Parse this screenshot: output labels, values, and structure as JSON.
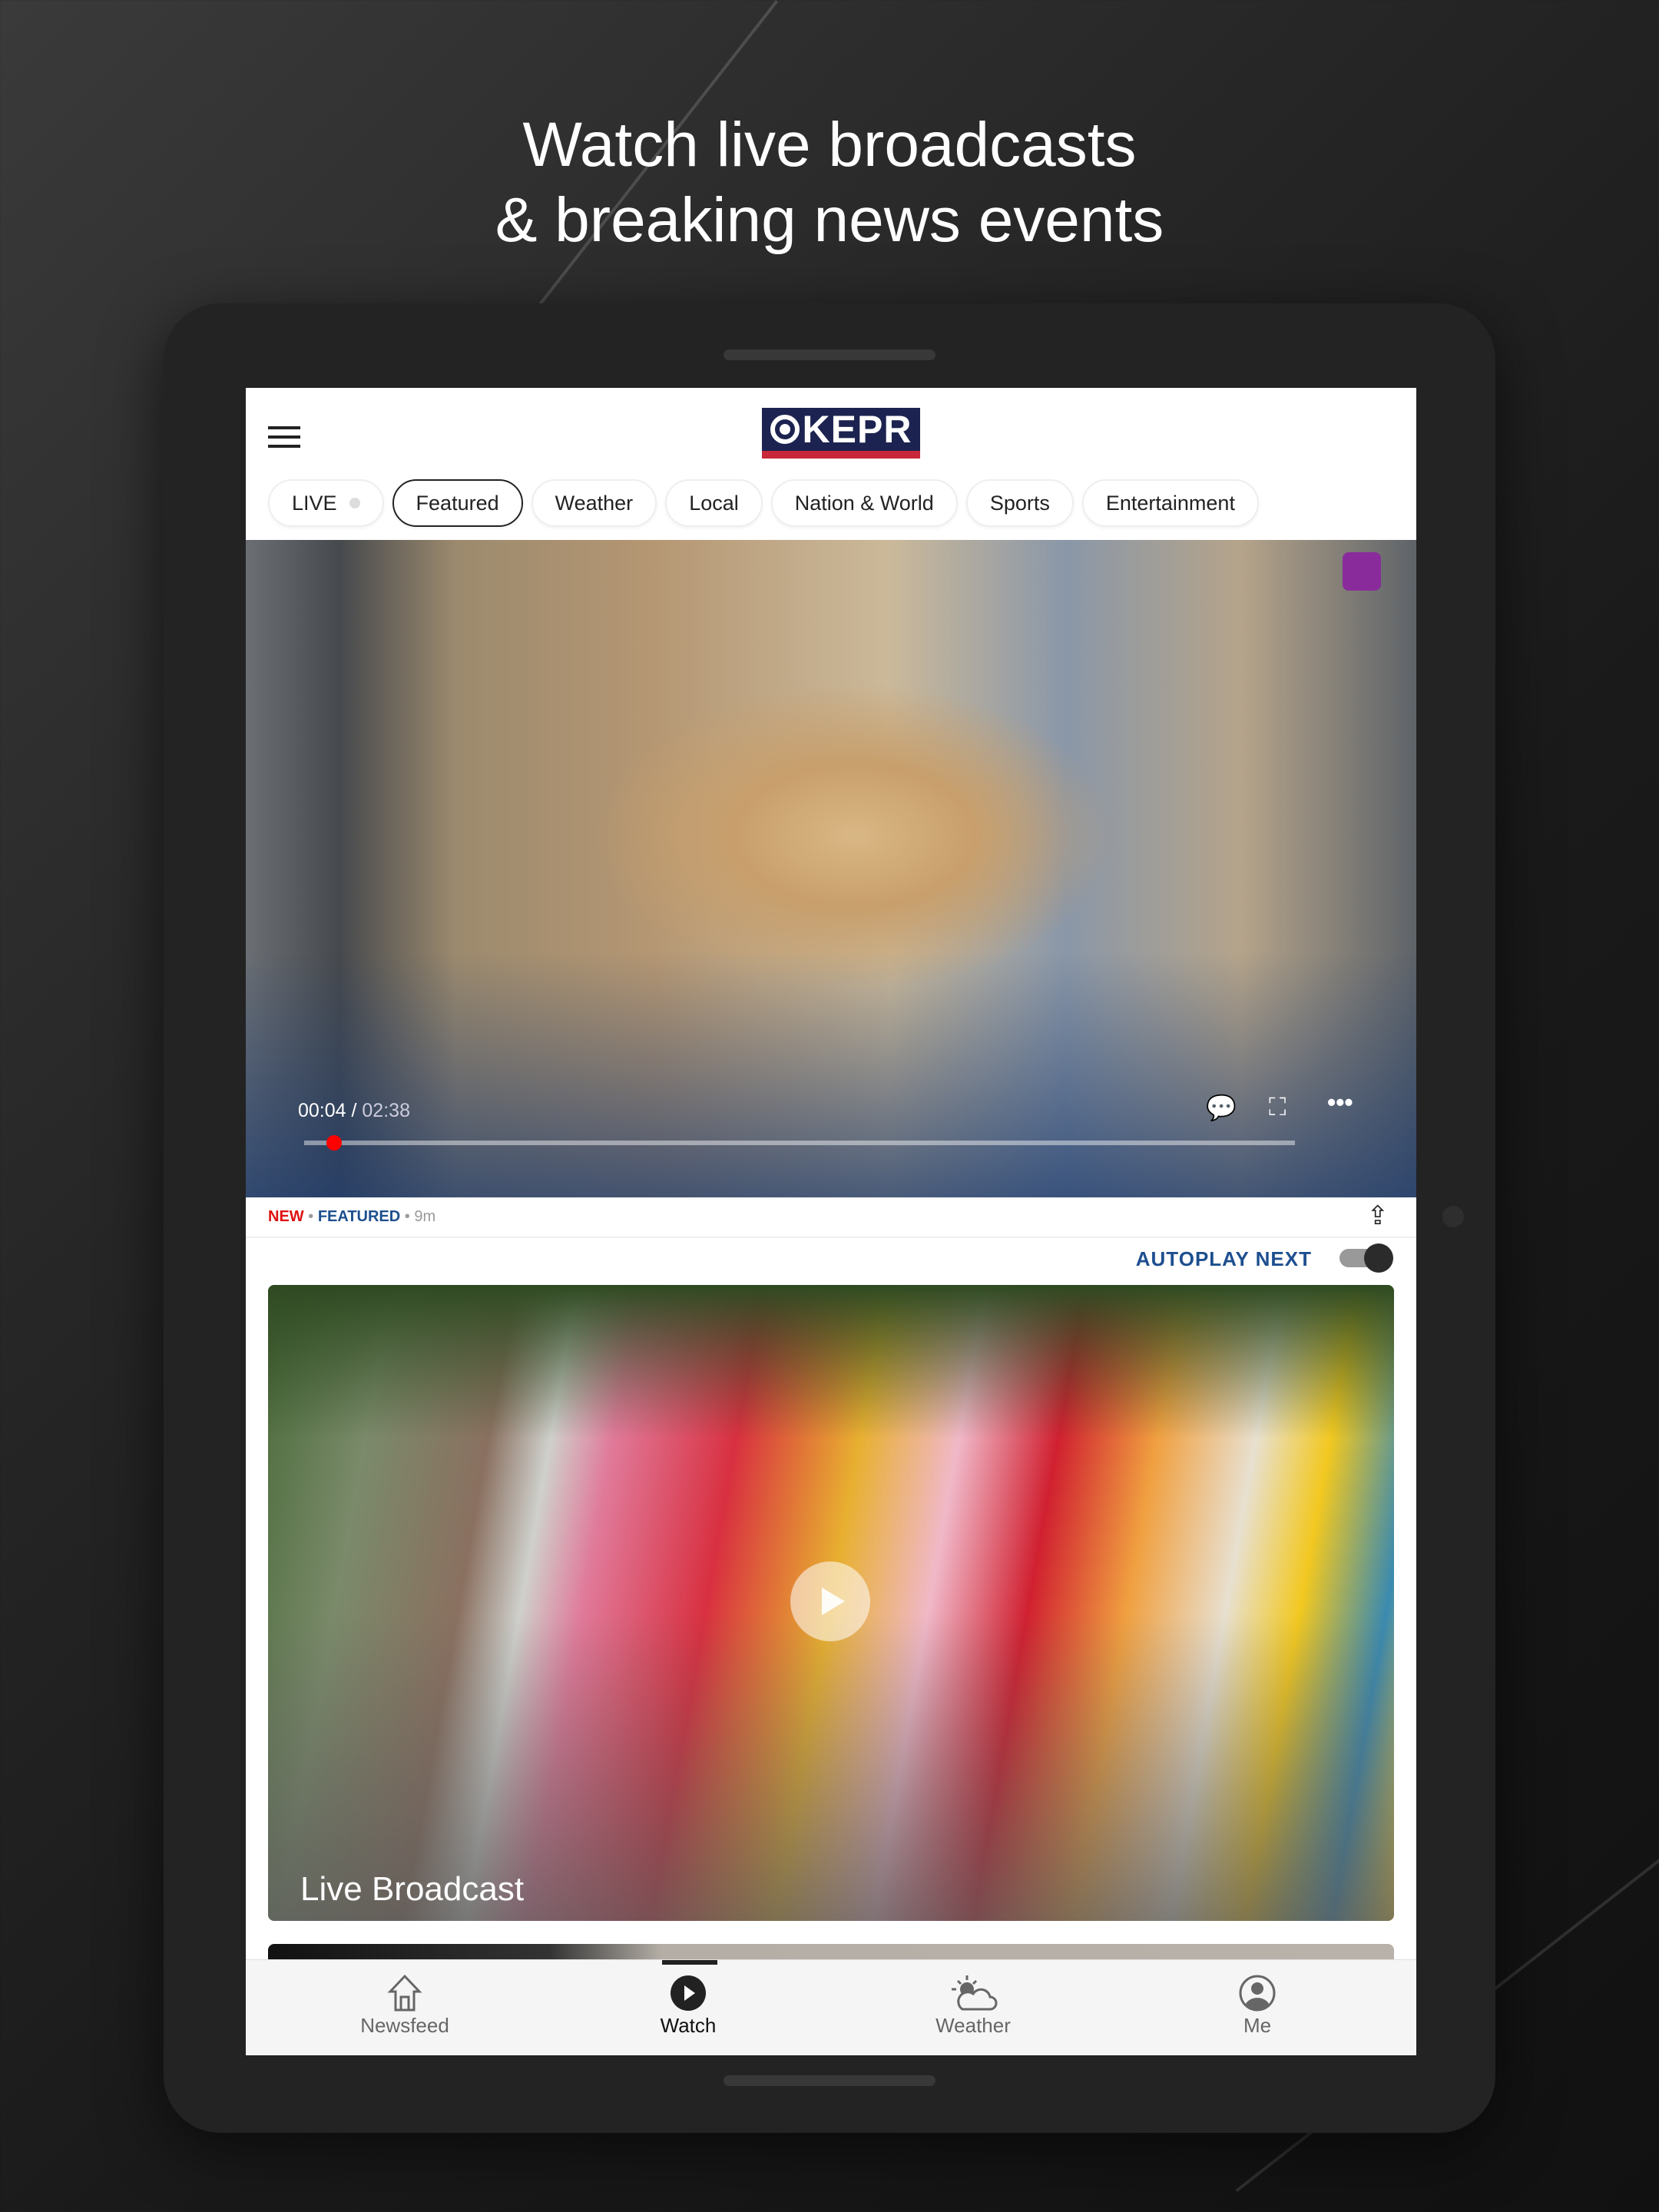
{
  "headline": {
    "line1": "Watch live broadcasts",
    "line2": "& breaking news events"
  },
  "header": {
    "logo_text": "KEPR",
    "menu_icon": "hamburger-icon"
  },
  "tabs": [
    {
      "label": "LIVE",
      "active": false
    },
    {
      "label": "Featured",
      "active": true
    },
    {
      "label": "Weather",
      "active": false
    },
    {
      "label": "Local",
      "active": false
    },
    {
      "label": "Nation & World",
      "active": false
    },
    {
      "label": "Sports",
      "active": false
    },
    {
      "label": "Entertainment",
      "active": false
    }
  ],
  "player": {
    "current_time": "00:04",
    "duration": "02:38",
    "progress_percent": 3
  },
  "article_meta": {
    "new": "NEW",
    "sep": "•",
    "category": "FEATURED",
    "age": "9m"
  },
  "autoplay": {
    "label": "AUTOPLAY NEXT",
    "enabled": true
  },
  "cards": [
    {
      "caption": "Live Broadcast"
    }
  ],
  "bottom_nav": [
    {
      "label": "Newsfeed",
      "icon": "home-icon"
    },
    {
      "label": "Watch",
      "icon": "play-circle-icon",
      "active": true
    },
    {
      "label": "Weather",
      "icon": "partly-cloudy-icon"
    },
    {
      "label": "Me",
      "icon": "user-icon"
    }
  ],
  "colors": {
    "accent_blue": "#1d4f8f",
    "new_red": "#e01010",
    "logo_navy": "#1c2350",
    "logo_red": "#c8283a"
  }
}
